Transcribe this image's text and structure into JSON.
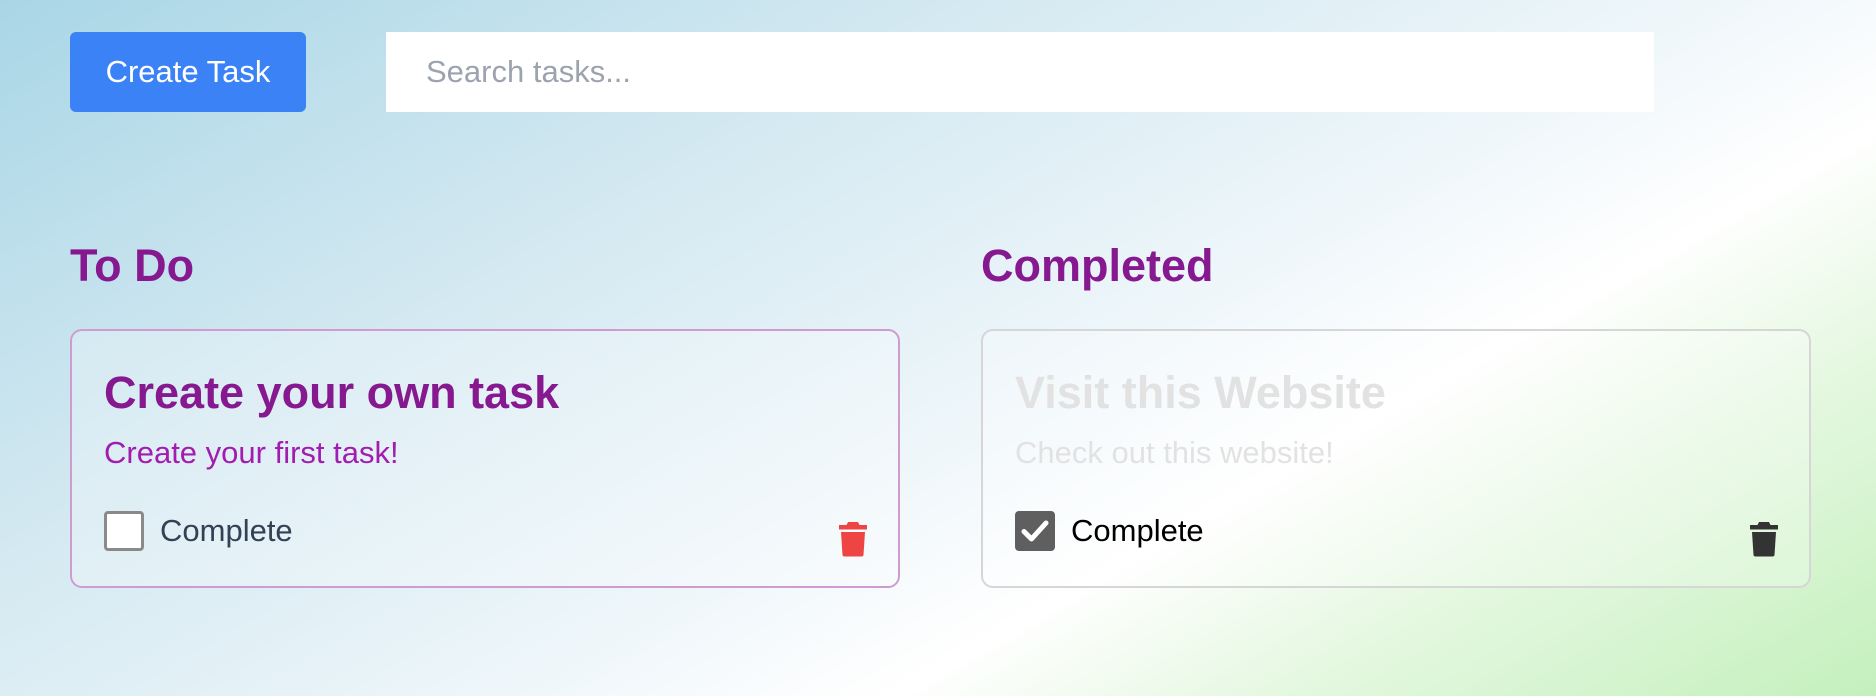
{
  "toolbar": {
    "create_label": "Create Task",
    "search_placeholder": "Search tasks...",
    "search_value": ""
  },
  "columns": [
    {
      "title": "To Do",
      "tasks": [
        {
          "title": "Create your own task",
          "description": "Create your first task!",
          "complete_label": "Complete",
          "checked": false,
          "delete_icon": "trash-icon",
          "delete_icon_color": "#ef4444"
        }
      ]
    },
    {
      "title": "Completed",
      "tasks": [
        {
          "title": "Visit this Website",
          "description": "Check out this website!",
          "complete_label": "Complete",
          "checked": true,
          "delete_icon": "trash-icon",
          "delete_icon_color": "#333333"
        }
      ]
    }
  ],
  "colors": {
    "primary_button": "#3b82f6",
    "heading": "#86198f",
    "todo_description": "#a21caf"
  }
}
